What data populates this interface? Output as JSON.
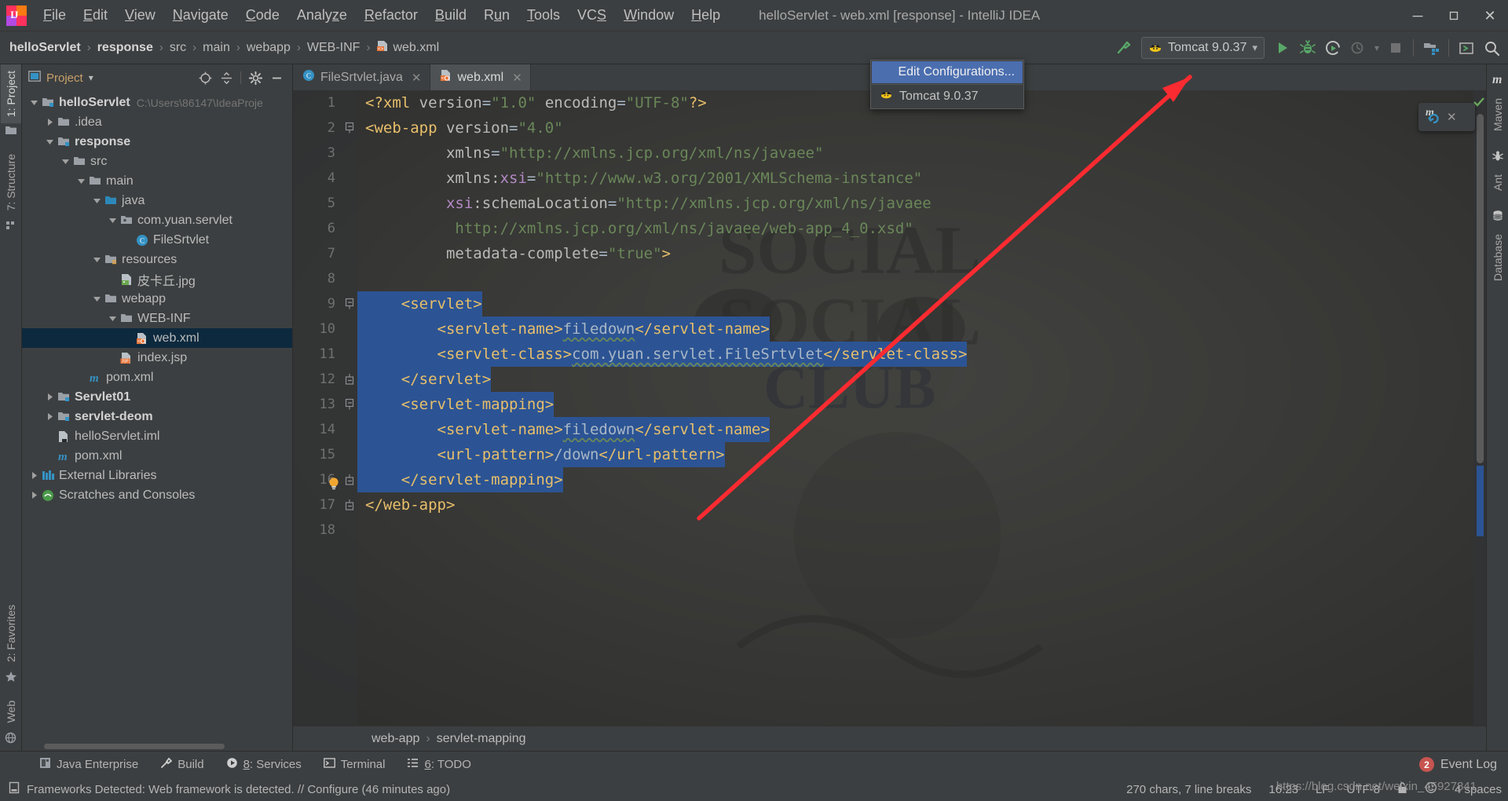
{
  "window": {
    "title": "helloServlet - web.xml [response] - IntelliJ IDEA",
    "minimize": "─",
    "maximize": "❐",
    "close": "✕"
  },
  "menubar": [
    {
      "label": "File",
      "mnemonic": "F"
    },
    {
      "label": "Edit",
      "mnemonic": "E"
    },
    {
      "label": "View",
      "mnemonic": "V"
    },
    {
      "label": "Navigate",
      "mnemonic": "N"
    },
    {
      "label": "Code",
      "mnemonic": "C"
    },
    {
      "label": "Analyze",
      "mnemonic": "z"
    },
    {
      "label": "Refactor",
      "mnemonic": "R"
    },
    {
      "label": "Build",
      "mnemonic": "B"
    },
    {
      "label": "Run",
      "mnemonic": "u"
    },
    {
      "label": "Tools",
      "mnemonic": "T"
    },
    {
      "label": "VCS",
      "mnemonic": "S"
    },
    {
      "label": "Window",
      "mnemonic": "W"
    },
    {
      "label": "Help",
      "mnemonic": "H"
    }
  ],
  "breadcrumbs": [
    {
      "label": "helloServlet",
      "bold": true
    },
    {
      "label": "response",
      "bold": true
    },
    {
      "label": "src",
      "bold": false
    },
    {
      "label": "main",
      "bold": false
    },
    {
      "label": "webapp",
      "bold": false
    },
    {
      "label": "WEB-INF",
      "bold": false
    },
    {
      "label": "web.xml",
      "bold": false,
      "icon": "xml-file-icon"
    }
  ],
  "toolbar": {
    "make_icon": "build-hammer-icon",
    "run_config": {
      "label": "Tomcat 9.0.37",
      "icon": "tomcat-icon",
      "chevron": "▾"
    },
    "run_label": "run-icon",
    "debug_label": "debug-icon",
    "run_coverage_label": "run-with-coverage-icon",
    "profiler_label": "profiler-icon",
    "stop_label": "stop-icon",
    "open_project_label": "project-structure-icon",
    "terminal_label": "terminal-icon",
    "search_label": "search-everywhere-icon"
  },
  "run_config_dropdown": {
    "visible": true,
    "items": [
      {
        "label": "Edit Configurations...",
        "selected": true,
        "icon": null
      },
      {
        "label": "Tomcat 9.0.37",
        "selected": false,
        "icon": "tomcat-icon"
      }
    ]
  },
  "left_strip": {
    "top": [
      {
        "label": "1: Project",
        "icon": "project-folder-icon",
        "active": true
      },
      {
        "label": "7: Structure",
        "icon": "structure-icon",
        "active": false
      }
    ],
    "bottom": [
      {
        "label": "2: Favorites",
        "icon": "star-icon",
        "active": false
      },
      {
        "label": "Web",
        "icon": "web-globe-icon",
        "active": false
      }
    ]
  },
  "right_strip": [
    {
      "label": "Maven",
      "icon": "maven-icon"
    },
    {
      "label": "Ant",
      "icon": "ant-icon"
    },
    {
      "label": "Database",
      "icon": "database-icon"
    }
  ],
  "project_panel": {
    "title": "Project",
    "title_icon": "project-view-icon",
    "chevron": "▾",
    "actions": [
      {
        "name": "scroll-from-source-icon"
      },
      {
        "name": "collapse-all-icon"
      },
      {
        "name": "settings-gear-icon"
      },
      {
        "name": "hide-panel-icon"
      }
    ],
    "tree": [
      {
        "indent": 0,
        "twist": "open",
        "icon": "module-folder-icon",
        "label": "helloServlet",
        "bold": true,
        "path": "C:\\Users\\86147\\IdeaProje",
        "selected": false
      },
      {
        "indent": 1,
        "twist": "closed",
        "icon": "folder-icon",
        "label": ".idea",
        "bold": false,
        "selected": false
      },
      {
        "indent": 1,
        "twist": "open",
        "icon": "module-folder-icon",
        "label": "response",
        "bold": true,
        "selected": false
      },
      {
        "indent": 2,
        "twist": "open",
        "icon": "folder-icon",
        "label": "src",
        "bold": false,
        "selected": false
      },
      {
        "indent": 3,
        "twist": "open",
        "icon": "folder-icon",
        "label": "main",
        "bold": false,
        "selected": false
      },
      {
        "indent": 4,
        "twist": "open",
        "icon": "source-root-icon",
        "label": "java",
        "bold": false,
        "selected": false
      },
      {
        "indent": 5,
        "twist": "open",
        "icon": "package-icon",
        "label": "com.yuan.servlet",
        "bold": false,
        "selected": false
      },
      {
        "indent": 6,
        "twist": "none",
        "icon": "java-class-icon",
        "label": "FileSrtvlet",
        "bold": false,
        "selected": false
      },
      {
        "indent": 4,
        "twist": "open",
        "icon": "resource-root-icon",
        "label": "resources",
        "bold": false,
        "selected": false
      },
      {
        "indent": 5,
        "twist": "none",
        "icon": "image-file-icon",
        "label": "皮卡丘.jpg",
        "bold": false,
        "selected": false
      },
      {
        "indent": 4,
        "twist": "open",
        "icon": "folder-icon",
        "label": "webapp",
        "bold": false,
        "selected": false
      },
      {
        "indent": 5,
        "twist": "open",
        "icon": "folder-icon",
        "label": "WEB-INF",
        "bold": false,
        "selected": false
      },
      {
        "indent": 6,
        "twist": "none",
        "icon": "xml-file-icon",
        "label": "web.xml",
        "bold": false,
        "selected": true
      },
      {
        "indent": 5,
        "twist": "none",
        "icon": "jsp-file-icon",
        "label": "index.jsp",
        "bold": false,
        "selected": false
      },
      {
        "indent": 3,
        "twist": "none",
        "icon": "maven-pom-icon",
        "label": "pom.xml",
        "bold": false,
        "selected": false
      },
      {
        "indent": 1,
        "twist": "closed",
        "icon": "module-folder-icon",
        "label": "Servlet01",
        "bold": true,
        "selected": false
      },
      {
        "indent": 1,
        "twist": "closed",
        "icon": "module-folder-icon",
        "label": "servlet-deom",
        "bold": true,
        "selected": false
      },
      {
        "indent": 1,
        "twist": "none",
        "icon": "iml-file-icon",
        "label": "helloServlet.iml",
        "bold": false,
        "selected": false
      },
      {
        "indent": 1,
        "twist": "none",
        "icon": "maven-pom-icon",
        "label": "pom.xml",
        "bold": false,
        "selected": false
      },
      {
        "indent": 0,
        "twist": "closed",
        "icon": "libraries-icon",
        "label": "External Libraries",
        "bold": false,
        "selected": false
      },
      {
        "indent": 0,
        "twist": "closed",
        "icon": "scratches-icon",
        "label": "Scratches and Consoles",
        "bold": false,
        "selected": false
      }
    ]
  },
  "editor": {
    "tabs": [
      {
        "label": "FileSrtvlet.java",
        "icon": "java-class-icon",
        "active": false,
        "close": "✕"
      },
      {
        "label": "web.xml",
        "icon": "xml-file-icon",
        "active": true,
        "close": "✕"
      }
    ],
    "breadcrumb": [
      {
        "label": "web-app"
      },
      {
        "label": "servlet-mapping"
      }
    ],
    "breadcrumb_sep": "›",
    "inspection_status": "ok-check-icon",
    "lines": [
      {
        "n": 1,
        "indent": 0,
        "fold": "none",
        "sel": false,
        "bulb": false,
        "parts": [
          {
            "t": "<?xml ",
            "c": "pi"
          },
          {
            "t": "version",
            "c": "attr"
          },
          {
            "t": "=",
            "c": "txt"
          },
          {
            "t": "\"1.0\"",
            "c": "str"
          },
          {
            "t": " encoding",
            "c": "attr"
          },
          {
            "t": "=",
            "c": "txt"
          },
          {
            "t": "\"UTF-8\"",
            "c": "str"
          },
          {
            "t": "?>",
            "c": "pi"
          }
        ]
      },
      {
        "n": 2,
        "indent": 0,
        "fold": "open",
        "sel": false,
        "bulb": false,
        "parts": [
          {
            "t": "<web-app ",
            "c": "tag"
          },
          {
            "t": "version",
            "c": "attr"
          },
          {
            "t": "=",
            "c": "txt"
          },
          {
            "t": "\"4.0\"",
            "c": "str"
          }
        ]
      },
      {
        "n": 3,
        "indent": 0,
        "fold": "none",
        "sel": false,
        "bulb": false,
        "parts": [
          {
            "t": "         xmlns",
            "c": "attr"
          },
          {
            "t": "=",
            "c": "txt"
          },
          {
            "t": "\"http://xmlns.jcp.org/xml/ns/javaee\"",
            "c": "str"
          }
        ]
      },
      {
        "n": 4,
        "indent": 0,
        "fold": "none",
        "sel": false,
        "bulb": false,
        "parts": [
          {
            "t": "         xmlns:",
            "c": "attr"
          },
          {
            "t": "xsi",
            "c": "attr-px"
          },
          {
            "t": "=",
            "c": "txt"
          },
          {
            "t": "\"http://www.w3.org/2001/XMLSchema-instance\"",
            "c": "str"
          }
        ]
      },
      {
        "n": 5,
        "indent": 0,
        "fold": "none",
        "sel": false,
        "bulb": false,
        "parts": [
          {
            "t": "         ",
            "c": "txt"
          },
          {
            "t": "xsi",
            "c": "attr-px"
          },
          {
            "t": ":schemaLocation",
            "c": "attr"
          },
          {
            "t": "=",
            "c": "txt"
          },
          {
            "t": "\"http://xmlns.jcp.org/xml/ns/javaee",
            "c": "str"
          }
        ]
      },
      {
        "n": 6,
        "indent": 0,
        "fold": "none",
        "sel": false,
        "bulb": false,
        "parts": [
          {
            "t": "          http://xmlns.jcp.org/xml/ns/javaee/web-app_4_0.xsd\"",
            "c": "str"
          }
        ]
      },
      {
        "n": 7,
        "indent": 0,
        "fold": "none",
        "sel": false,
        "bulb": false,
        "parts": [
          {
            "t": "         metadata-complete",
            "c": "attr"
          },
          {
            "t": "=",
            "c": "txt"
          },
          {
            "t": "\"true\"",
            "c": "str"
          },
          {
            "t": ">",
            "c": "tag"
          }
        ]
      },
      {
        "n": 8,
        "indent": 0,
        "fold": "none",
        "sel": false,
        "bulb": false,
        "parts": []
      },
      {
        "n": 9,
        "indent": 0,
        "fold": "open",
        "sel": true,
        "bulb": false,
        "parts": [
          {
            "t": "    <servlet>",
            "c": "tag"
          }
        ]
      },
      {
        "n": 10,
        "indent": 0,
        "fold": "none",
        "sel": true,
        "bulb": false,
        "parts": [
          {
            "t": "        <servlet-name>",
            "c": "tag"
          },
          {
            "t": "filedown",
            "c": "txt squig"
          },
          {
            "t": "</servlet-name>",
            "c": "tag"
          }
        ]
      },
      {
        "n": 11,
        "indent": 0,
        "fold": "none",
        "sel": true,
        "bulb": false,
        "parts": [
          {
            "t": "        <servlet-class>",
            "c": "tag"
          },
          {
            "t": "com.yuan.servlet.FileSrtvlet",
            "c": "txt squig"
          },
          {
            "t": "</servlet-class>",
            "c": "tag"
          }
        ]
      },
      {
        "n": 12,
        "indent": 0,
        "fold": "close",
        "sel": true,
        "bulb": false,
        "parts": [
          {
            "t": "    </servlet>",
            "c": "tag"
          }
        ]
      },
      {
        "n": 13,
        "indent": 0,
        "fold": "open",
        "sel": true,
        "bulb": false,
        "parts": [
          {
            "t": "    <servlet-mapping>",
            "c": "tag"
          }
        ]
      },
      {
        "n": 14,
        "indent": 0,
        "fold": "none",
        "sel": true,
        "bulb": false,
        "parts": [
          {
            "t": "        <servlet-name>",
            "c": "tag"
          },
          {
            "t": "filedown",
            "c": "txt squig"
          },
          {
            "t": "</servlet-name>",
            "c": "tag"
          }
        ]
      },
      {
        "n": 15,
        "indent": 0,
        "fold": "none",
        "sel": true,
        "bulb": false,
        "parts": [
          {
            "t": "        <url-pattern>",
            "c": "tag"
          },
          {
            "t": "/down",
            "c": "txt"
          },
          {
            "t": "</url-pattern>",
            "c": "tag"
          }
        ]
      },
      {
        "n": 16,
        "indent": 0,
        "fold": "close",
        "sel": true,
        "bulb": true,
        "parts": [
          {
            "t": "    </servlet-mapping>",
            "c": "tag"
          }
        ]
      },
      {
        "n": 17,
        "indent": 0,
        "fold": "close",
        "sel": false,
        "bulb": false,
        "parts": [
          {
            "t": "</web-app>",
            "c": "tag"
          }
        ]
      },
      {
        "n": 18,
        "indent": 0,
        "fold": "none",
        "sel": false,
        "bulb": false,
        "parts": []
      }
    ]
  },
  "maven_toast": {
    "icon": "maven-reload-icon",
    "close": "✕"
  },
  "bottom_toolwindows": [
    {
      "label": "Java Enterprise",
      "icon": "java-enterprise-icon",
      "mnemonic": null
    },
    {
      "label": "Build",
      "icon": "build-hammer-icon",
      "mnemonic": null
    },
    {
      "label": "8: Services",
      "icon": "services-icon",
      "mnemonic": "8"
    },
    {
      "label": "Terminal",
      "icon": "terminal-icon",
      "mnemonic": null
    },
    {
      "label": "6: TODO",
      "icon": "todo-icon",
      "mnemonic": "6"
    }
  ],
  "event_log": {
    "label": "Event Log",
    "count": "2"
  },
  "statusbar": {
    "message": "Frameworks Detected: Web framework is detected. // Configure (46 minutes ago)",
    "message_icon": "notification-icon",
    "chars_info": "270 chars, 7 line breaks",
    "time": "16:23",
    "line_sep": "LF",
    "encoding": "UTF-8",
    "lock_icon": "unlocked-icon",
    "indent": "4 spaces",
    "inspection_icon": "inspection-face-icon"
  },
  "watermark": {
    "text": "https://blog.csdn.net/weixin_45927841"
  },
  "colors": {
    "accent_blue": "#4b6eaf",
    "selection": "#2c5494",
    "tree_selection": "#0d293e",
    "panel_bg": "#3c3f41",
    "editor_bg": "#2b2b2b",
    "tag": "#e8bf6a",
    "string": "#6a8759",
    "text": "#a9b7c6",
    "arrow_red": "#fa2b31",
    "green_run": "#59a869"
  }
}
